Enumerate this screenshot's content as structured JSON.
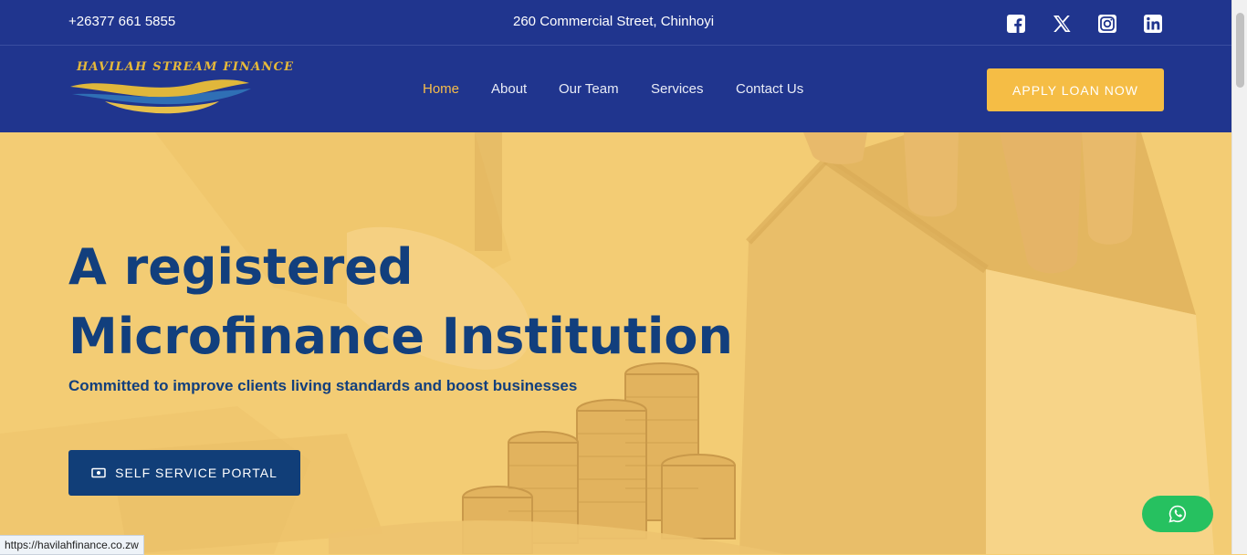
{
  "topbar": {
    "phone": "+26377 661 5855",
    "address": "260 Commercial Street, Chinhoyi",
    "social": [
      {
        "icon": "facebook-icon"
      },
      {
        "icon": "x-twitter-icon"
      },
      {
        "icon": "instagram-icon"
      },
      {
        "icon": "linkedin-icon"
      }
    ]
  },
  "brand": {
    "logo_text": "HAVILAH STREAM FINANCE",
    "colors": {
      "navy": "#20358e",
      "gold": "#f5bd45",
      "text_blue": "#123f7d",
      "button_blue": "#113e78",
      "whatsapp": "#26c160"
    }
  },
  "nav": {
    "items": [
      {
        "label": "Home",
        "active": true
      },
      {
        "label": "About",
        "active": false
      },
      {
        "label": "Our Team",
        "active": false
      },
      {
        "label": "Services",
        "active": false
      },
      {
        "label": "Contact Us",
        "active": false
      }
    ],
    "cta": "APPLY LOAN NOW"
  },
  "hero": {
    "title_line1": "A registered",
    "title_line2": "Microfinance Institution",
    "subtitle": "Committed to improve clients living standards and boost businesses",
    "portal_button": "SELF SERVICE PORTAL",
    "portal_icon": "money-bill-icon"
  },
  "floating": {
    "whatsapp_icon": "whatsapp-icon"
  },
  "status_bar": {
    "url": "https://havilahfinance.co.zw"
  }
}
